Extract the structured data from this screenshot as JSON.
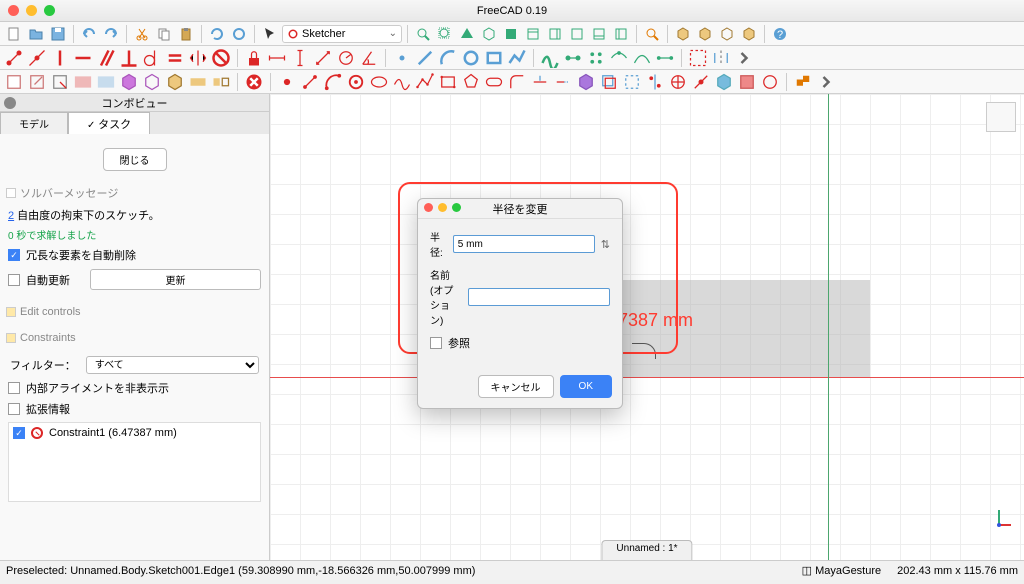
{
  "window": {
    "title": "FreeCAD 0.19"
  },
  "workbench": {
    "selected": "Sketcher"
  },
  "panel": {
    "title": "コンボビュー",
    "tabs": {
      "model": "モデル",
      "task": "タスク"
    },
    "close": "閉じる",
    "solver_header": "ソルバーメッセージ",
    "dof_prefix": "2",
    "dof_text": " 自由度の拘束下のスケッチ。",
    "solve_time": "0 秒で求解しました",
    "auto_delete": "冗長な要素を自動削除",
    "auto_update": "自動更新",
    "update_btn": "更新",
    "edit_controls": "Edit controls",
    "constraints_header": "Constraints",
    "filter_label": "フィルター：",
    "filter_value": "すべて",
    "hide_internal": "内部アライメントを非表示示",
    "ext_info": "拡張情報",
    "constraint_item": "Constraint1 (6.47387 mm)"
  },
  "canvas": {
    "dimension_text": "7387 mm",
    "tab_label": "Unnamed : 1*"
  },
  "dialog": {
    "title": "半径を変更",
    "radius_label": "半径:",
    "radius_value": "5 mm",
    "name_label": "名前 (オプション)",
    "name_value": "",
    "ref_label": "参照",
    "cancel": "キャンセル",
    "ok": "OK"
  },
  "status": {
    "preselected": "Preselected: Unnamed.Body.Sketch001.Edge1 (59.308990 mm,-18.566326 mm,50.007999 mm)",
    "nav_style": "MayaGesture",
    "dims": "202.43 mm x 115.76 mm"
  }
}
